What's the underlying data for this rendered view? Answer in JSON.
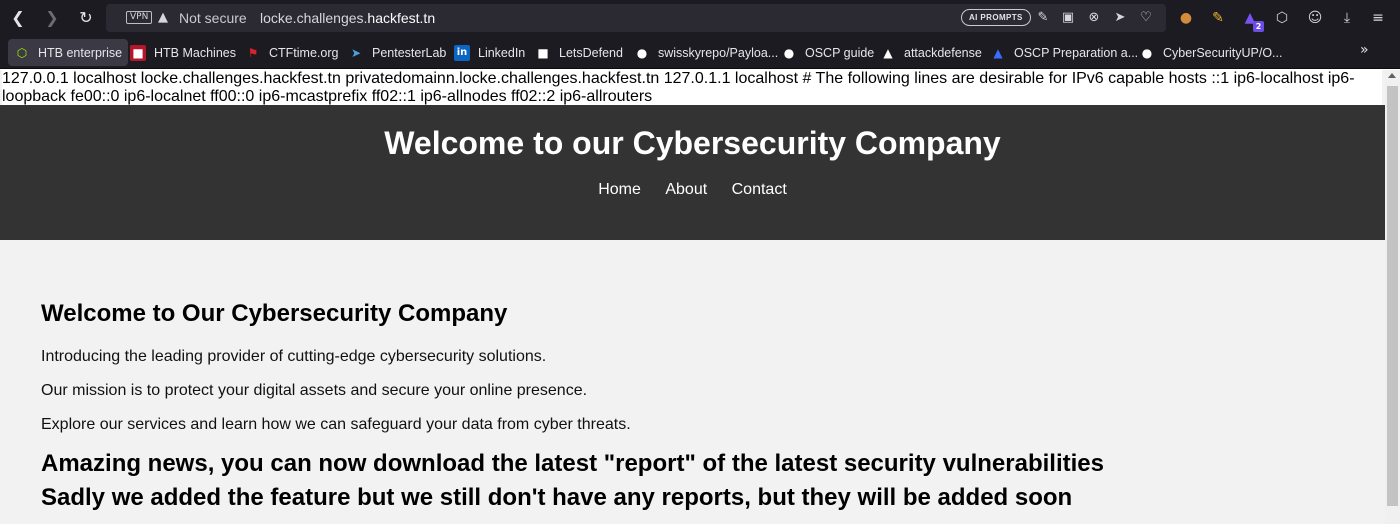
{
  "browser": {
    "vpn_label": "VPN",
    "security_label": "Not secure",
    "url_prefix": "locke.challenges.",
    "url_domain": "hackfest.tn",
    "ai_prompts_label": "AI PROMPTS",
    "extension_badge": "2"
  },
  "bookmarks": [
    {
      "label": "HTB enterprise",
      "icon": "htb-cube-icon",
      "color": "#9fef00"
    },
    {
      "label": "HTB Machines",
      "icon": "htb-machines-icon",
      "color": "#b5172a"
    },
    {
      "label": "CTFtime.org",
      "icon": "ctftime-flag-icon",
      "color": "#d8232a"
    },
    {
      "label": "PentesterLab",
      "icon": "pentesterlab-icon",
      "color": "#4aa3df"
    },
    {
      "label": "LinkedIn",
      "icon": "linkedin-icon",
      "color": "#0a66c2"
    },
    {
      "label": "LetsDefend",
      "icon": "letsdefend-icon",
      "color": "#ffffff"
    },
    {
      "label": "swisskyrepo/Payloa...",
      "icon": "github-icon",
      "color": "#ffffff"
    },
    {
      "label": "OSCP guide",
      "icon": "github-icon",
      "color": "#ffffff"
    },
    {
      "label": "attackdefense",
      "icon": "attackdefense-icon",
      "color": "#ffffff"
    },
    {
      "label": "OSCP Preparation a...",
      "icon": "oscp-prep-icon",
      "color": "#1f3fa8"
    },
    {
      "label": "CyberSecurityUP/O...",
      "icon": "github-icon",
      "color": "#ffffff"
    }
  ],
  "page": {
    "hosts_text": "127.0.0.1 localhost locke.challenges.hackfest.tn privatedomainn.locke.challenges.hackfest.tn 127.0.1.1 localhost # The following lines are desirable for IPv6 capable hosts ::1 ip6-localhost ip6-loopback fe00::0 ip6-localnet ff00::0 ip6-mcastprefix ff02::1 ip6-allnodes ff02::2 ip6-allrouters",
    "header_title": "Welcome to our Cybersecurity Company",
    "nav": [
      "Home",
      "About",
      "Contact"
    ],
    "heading": "Welcome to Our Cybersecurity Company",
    "paragraphs": [
      "Introducing the leading provider of cutting-edge cybersecurity solutions.",
      "Our mission is to protect your digital assets and secure your online presence.",
      "Explore our services and learn how we can safeguard your data from cyber threats."
    ],
    "news_line1": "Amazing news, you can now download the latest \"report\" of the latest security vulnerabilities",
    "news_line2": "Sadly we added the feature but we still don't have any reports, but they will be added soon"
  },
  "colors": {
    "header_bg": "#333333",
    "page_bg": "#f2f2f2",
    "chrome_bg": "#1c1b22"
  }
}
